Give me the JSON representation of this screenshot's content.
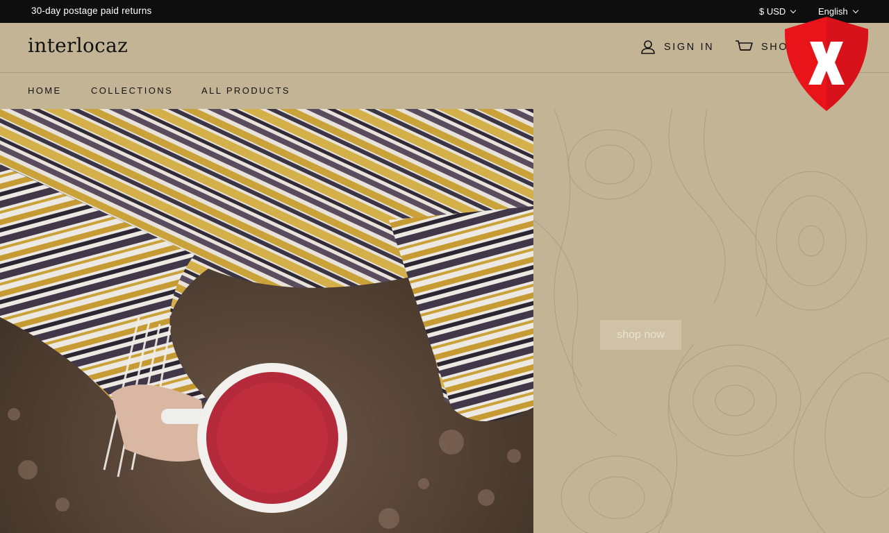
{
  "topbar": {
    "announcement": "30-day postage paid returns",
    "currency": "$ USD",
    "language": "English"
  },
  "header": {
    "logo": "interlocaz",
    "signin_label": "SIGN IN",
    "shop_label": "SHO"
  },
  "nav": {
    "items": [
      {
        "label": "HOME"
      },
      {
        "label": "COLLECTIONS"
      },
      {
        "label": "ALL PRODUCTS"
      }
    ]
  },
  "hero": {
    "button_label": "shop now",
    "image_description_icon": "blanket-tea-photo"
  },
  "overlay": {
    "icon": "red-shield-x-icon"
  },
  "colors": {
    "background": "#c4b496",
    "topbar": "#0e0e0e",
    "shield": "#e8141a"
  }
}
